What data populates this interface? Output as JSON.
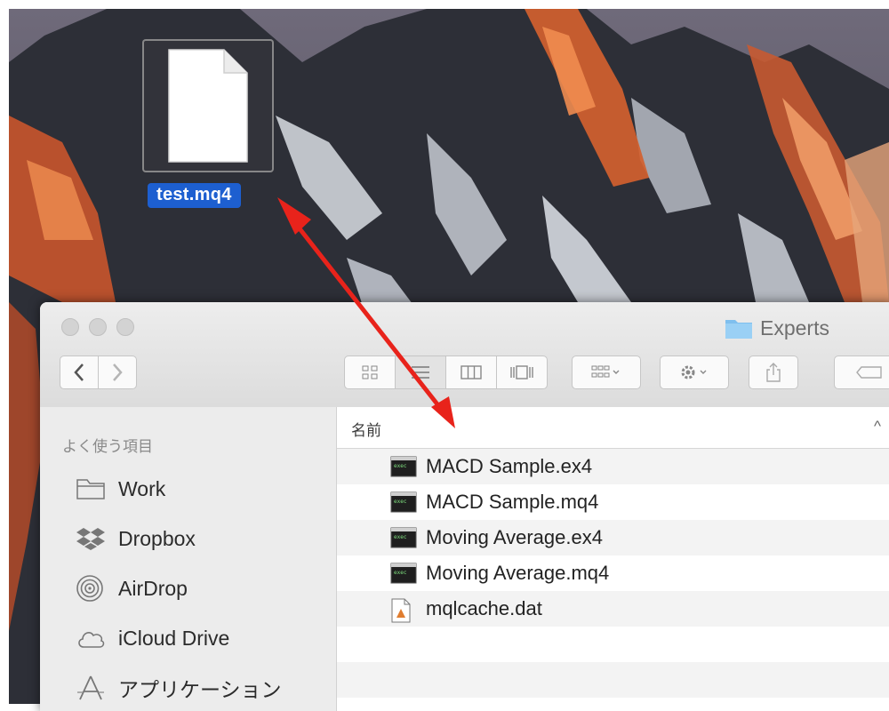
{
  "desktop": {
    "file": {
      "name": "test.mq4",
      "icon": "document-icon"
    }
  },
  "window": {
    "title": "Experts",
    "title_icon": "folder-icon",
    "toolbar": {
      "back": "back-icon",
      "forward": "forward-icon",
      "views": [
        "icon-view-icon",
        "list-view-icon",
        "column-view-icon",
        "coverflow-view-icon"
      ],
      "arrange": "arrange-icon",
      "action": "gear-icon",
      "share": "share-icon",
      "tags": "tag-icon"
    }
  },
  "sidebar": {
    "heading": "よく使う項目",
    "items": [
      {
        "label": "Work",
        "icon": "folder-icon"
      },
      {
        "label": "Dropbox",
        "icon": "dropbox-icon"
      },
      {
        "label": "AirDrop",
        "icon": "airdrop-icon"
      },
      {
        "label": "iCloud Drive",
        "icon": "cloud-icon"
      },
      {
        "label": "アプリケーション",
        "icon": "applications-icon"
      }
    ]
  },
  "filelist": {
    "column_header": "名前",
    "sort_indicator": "^",
    "rows": [
      {
        "name": "MACD Sample.ex4",
        "icon": "executable-icon"
      },
      {
        "name": "MACD Sample.mq4",
        "icon": "executable-icon"
      },
      {
        "name": "Moving Average.ex4",
        "icon": "executable-icon"
      },
      {
        "name": "Moving Average.mq4",
        "icon": "executable-icon"
      },
      {
        "name": "mqlcache.dat",
        "icon": "data-file-icon"
      }
    ]
  },
  "colors": {
    "selection": "#1d5fd0",
    "arrow": "#e8231b"
  }
}
